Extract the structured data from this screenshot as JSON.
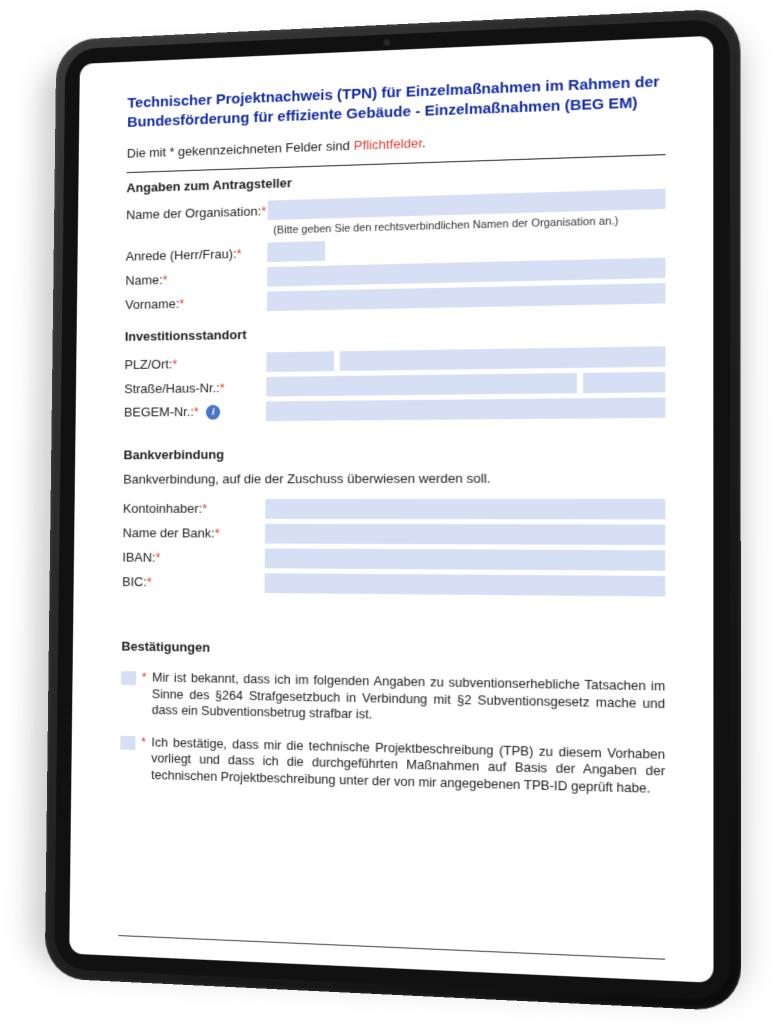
{
  "title": "Technischer Projektnachweis (TPN) für Einzelmaßnahmen im Rahmen der Bundesförderung für effiziente Gebäude - Einzelmaßnahmen (BEG EM)",
  "mandatory_prefix": "Die mit * gekennzeichneten Felder sind ",
  "mandatory_word": "Pflichtfelder",
  "sections": {
    "applicant": {
      "heading": "Angaben zum Antragsteller",
      "org_label": "Name der Organisation:",
      "org_hint": "(Bitte geben Sie den rechtsverbindlichen Namen der Organisation an.)",
      "anrede_label": "Anrede (Herr/Frau):",
      "name_label": "Name:",
      "vorname_label": "Vorname:"
    },
    "location": {
      "heading": "Investitionsstandort",
      "plzort_label": "PLZ/Ort:",
      "strasse_label": "Straße/Haus-Nr.:",
      "begem_label": "BEGEM-Nr.:"
    },
    "bank": {
      "heading": "Bankverbindung",
      "subnote": "Bankverbindung, auf die der Zuschuss überwiesen werden soll.",
      "kontoinhaber_label": "Kontoinhaber:",
      "bankname_label": "Name der Bank:",
      "iban_label": "IBAN:",
      "bic_label": "BIC:"
    },
    "confirm": {
      "heading": "Bestätigungen",
      "item1": "Mir ist bekannt, dass ich im folgenden Angaben zu subventionserhebliche Tatsachen im Sinne des §264 Strafgesetzbuch in Verbindung mit §2 Subventionsgesetz mache und dass ein Subventionsbetrug strafbar ist.",
      "item2": "Ich bestätige, dass mir die technische Projektbeschreibung (TPB) zu diesem Vorhaben vorliegt und dass ich die durchgeführten Maßnahmen auf Basis der Angaben der technischen Projektbeschreibung unter der von mir angegebenen TPB-ID geprüft habe."
    }
  },
  "info_glyph": "i",
  "dot": "."
}
